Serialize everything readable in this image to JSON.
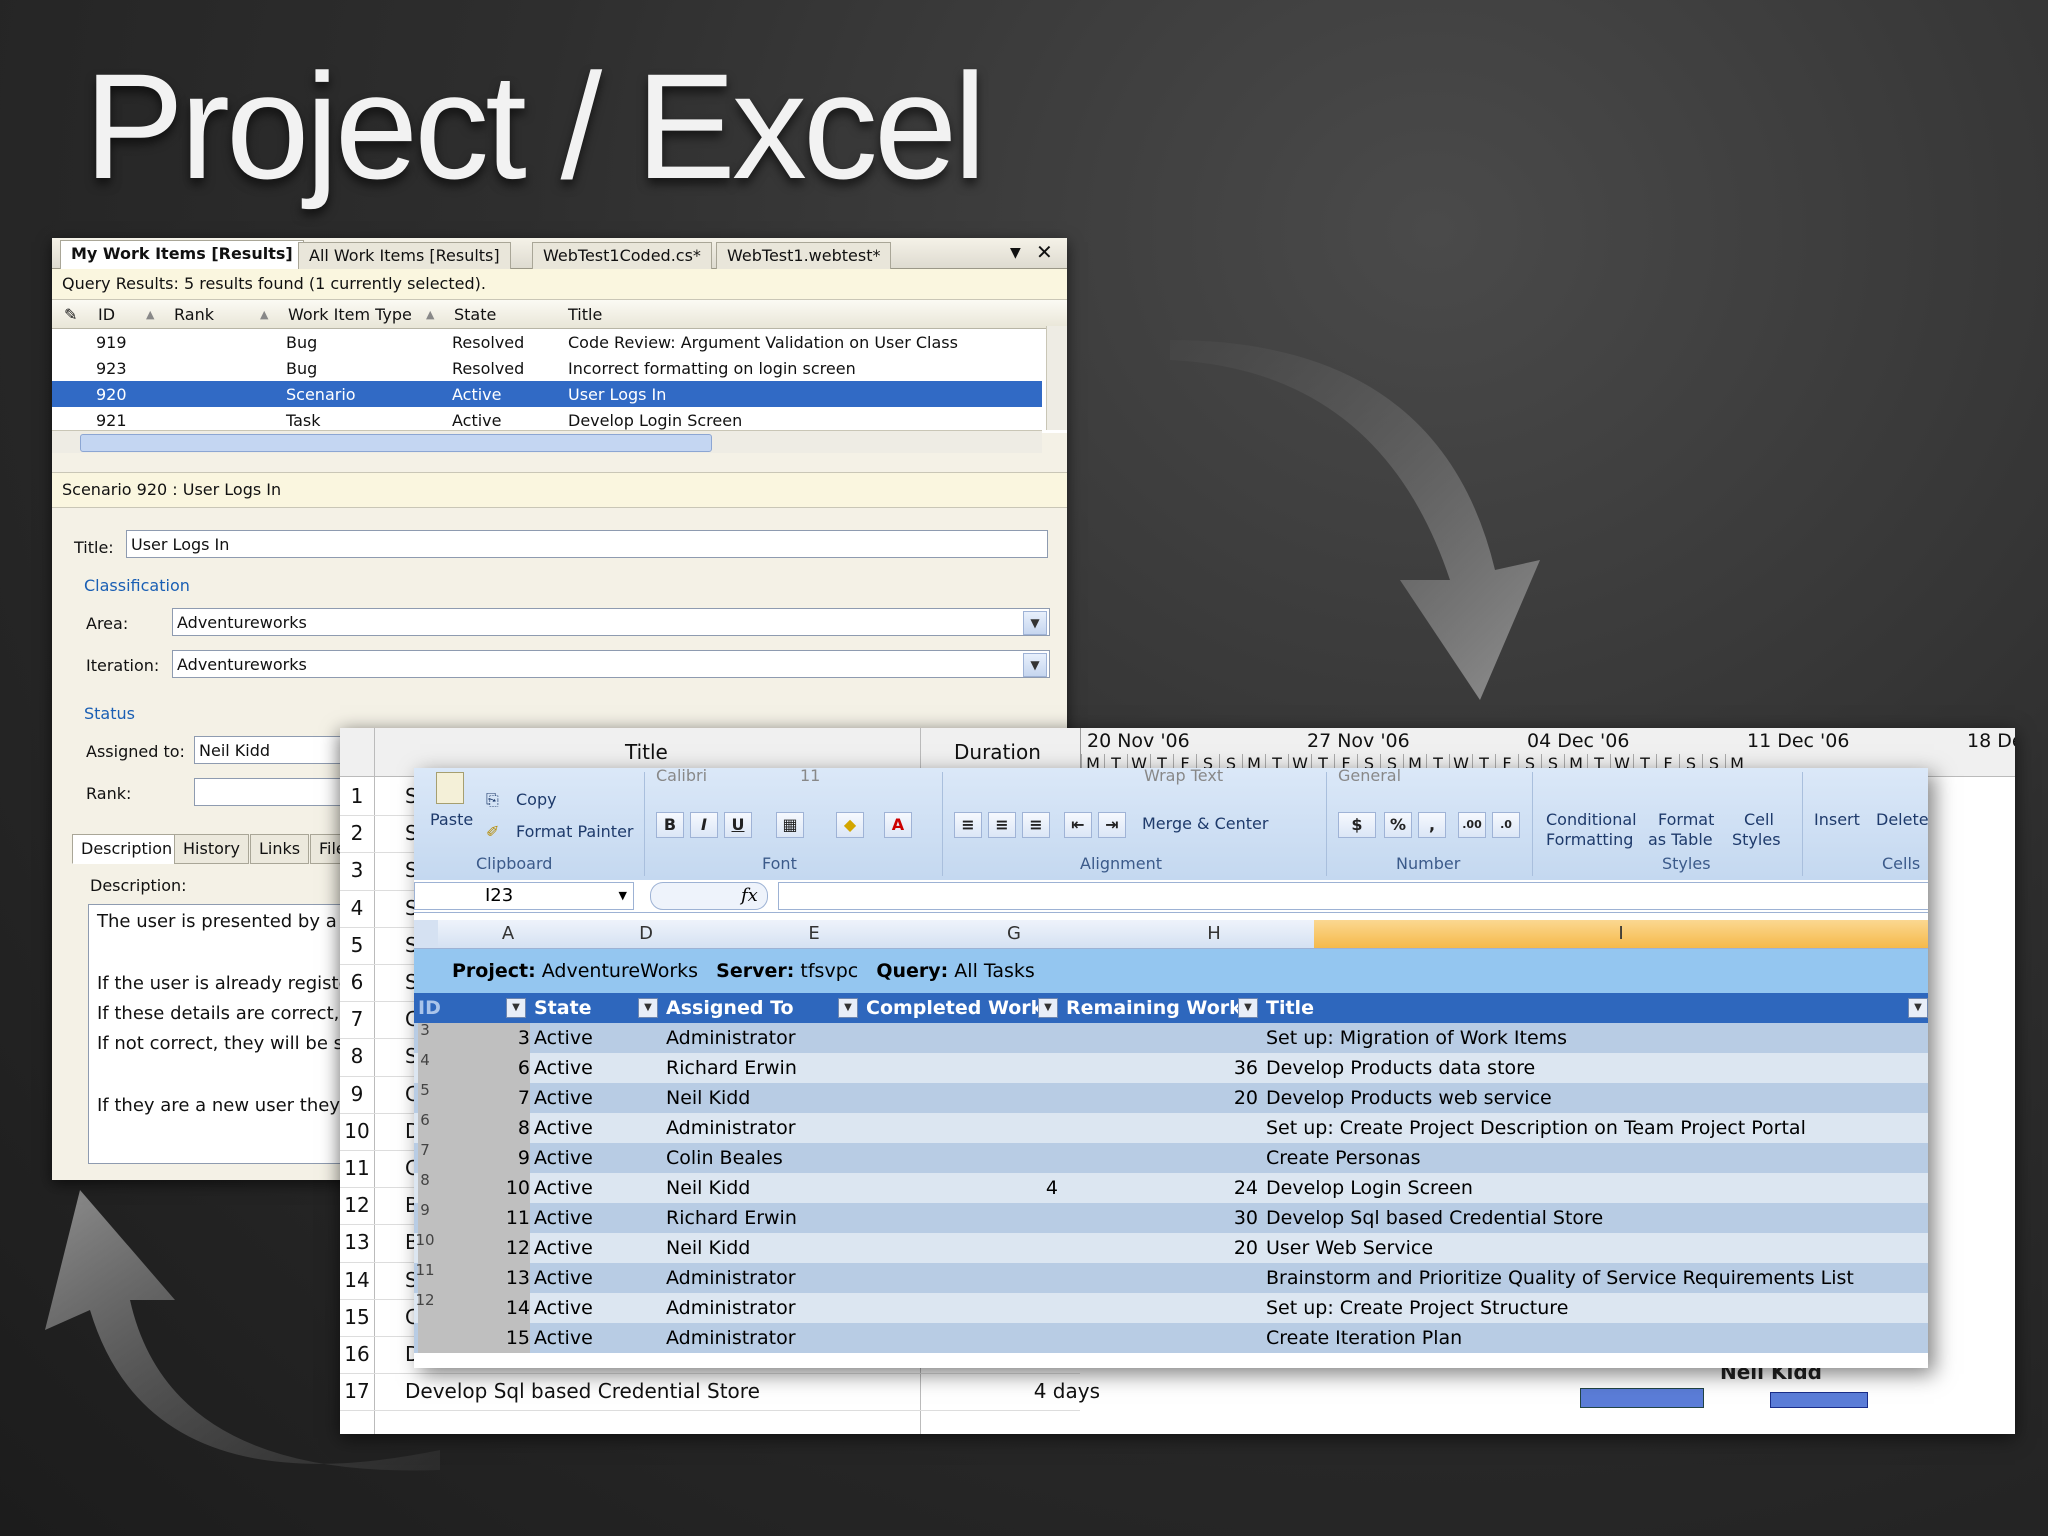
{
  "slide": {
    "title": "Project / Excel"
  },
  "vs": {
    "tabs": [
      "My Work Items [Results]",
      "All Work Items [Results]",
      "WebTest1Coded.cs*",
      "WebTest1.webtest*"
    ],
    "query_info": "Query Results: 5 results found (1 currently selected).",
    "columns": [
      "ID",
      "Rank",
      "Work Item Type",
      "State",
      "Title"
    ],
    "rows": [
      {
        "id": "919",
        "type": "Bug",
        "state": "Resolved",
        "title": "Code Review: Argument Validation on User Class"
      },
      {
        "id": "923",
        "type": "Bug",
        "state": "Resolved",
        "title": "Incorrect formatting on login screen"
      },
      {
        "id": "920",
        "type": "Scenario",
        "state": "Active",
        "title": "User Logs In"
      },
      {
        "id": "921",
        "type": "Task",
        "state": "Active",
        "title": "Develop Login Screen"
      }
    ],
    "form_header": "Scenario 920 : User Logs In",
    "title_label": "Title:",
    "title_value": "User Logs In",
    "classification_label": "Classification",
    "area_label": "Area:",
    "area_value": "Adventureworks",
    "iteration_label": "Iteration:",
    "iteration_value": "Adventureworks",
    "status_label": "Status",
    "assigned_label": "Assigned to:",
    "assigned_value": "Neil Kidd",
    "rank_label": "Rank:",
    "subtabs": [
      "Description",
      "History",
      "Links",
      "File"
    ],
    "description_label": "Description:",
    "description_lines": [
      "The user is presented by a l",
      "",
      "If the user is already registe",
      "If these details are correct, t",
      "If not correct, they will be sh",
      "",
      "If they are a new user they a"
    ]
  },
  "project": {
    "col_title": "Title",
    "col_duration": "Duration",
    "row_numbers": [
      "1",
      "2",
      "3",
      "4",
      "5",
      "6",
      "7",
      "8",
      "9",
      "10",
      "11",
      "12",
      "13",
      "14",
      "15",
      "16",
      "17"
    ],
    "row_prefixes": [
      "Se",
      "Se",
      "Se",
      "Se",
      "Se",
      "Se",
      "Cr",
      "Se",
      "Cr",
      "De",
      "Cr",
      "Bi",
      "Bi",
      "Se",
      "Cr",
      "Develop Login Screen",
      "Develop Sql based Credential Store"
    ],
    "durations": {
      "16": "4 days",
      "17": "4 days"
    },
    "weeks": [
      "20 Nov '06",
      "27 Nov '06",
      "04 Dec '06",
      "11 Dec '06",
      "18 De"
    ],
    "day_letters": "MTWTFSSMTWTFSSMTWTFSSMTWTFSSM",
    "resource_label_1": "Neil Kidd",
    "resource_label_2": "Neil Kidd"
  },
  "excel": {
    "ribbon": {
      "paste": "Paste",
      "copy": "Copy",
      "format_painter": "Format Painter",
      "clipboard": "Clipboard",
      "font_name": "Calibri",
      "font_size": "11",
      "font": "Font",
      "wrap_text": "Wrap Text",
      "merge_center": "Merge & Center",
      "alignment": "Alignment",
      "number_format": "General",
      "number": "Number",
      "conditional": "Conditional",
      "formatting": "Formatting",
      "format": "Format",
      "as_table": "as Table",
      "cell": "Cell",
      "styles_btn": "Styles",
      "styles": "Styles",
      "insert": "Insert",
      "delete": "Delete",
      "cells": "Cells"
    },
    "name_box": "I23",
    "fx": "fx",
    "col_letters": [
      "A",
      "D",
      "E",
      "G",
      "H",
      "I"
    ],
    "project_label": "Project:",
    "project_value": "AdventureWorks",
    "server_label": "Server:",
    "server_value": "tfsvpc",
    "query_label": "Query:",
    "query_value": "All Tasks",
    "headers": [
      "ID",
      "State",
      "Assigned To",
      "Completed Work",
      "Remaining Work",
      "Title"
    ],
    "gutter": [
      "3",
      "4",
      "5",
      "6",
      "7",
      "8",
      "9",
      "10",
      "11",
      "12"
    ],
    "rows": [
      {
        "id": "3",
        "state": "Active",
        "assigned": "Administrator",
        "completed": "",
        "remaining": "",
        "title": "Set up: Migration of Work Items"
      },
      {
        "id": "6",
        "state": "Active",
        "assigned": "Richard Erwin",
        "completed": "",
        "remaining": "36",
        "title": "Develop Products data store"
      },
      {
        "id": "7",
        "state": "Active",
        "assigned": "Neil Kidd",
        "completed": "",
        "remaining": "20",
        "title": "Develop Products web service"
      },
      {
        "id": "8",
        "state": "Active",
        "assigned": "Administrator",
        "completed": "",
        "remaining": "",
        "title": "Set up: Create Project Description on Team Project Portal"
      },
      {
        "id": "9",
        "state": "Active",
        "assigned": "Colin Beales",
        "completed": "",
        "remaining": "",
        "title": "Create Personas"
      },
      {
        "id": "10",
        "state": "Active",
        "assigned": "Neil Kidd",
        "completed": "4",
        "remaining": "24",
        "title": "Develop Login Screen"
      },
      {
        "id": "11",
        "state": "Active",
        "assigned": "Richard Erwin",
        "completed": "",
        "remaining": "30",
        "title": "Develop Sql based Credential Store"
      },
      {
        "id": "12",
        "state": "Active",
        "assigned": "Neil Kidd",
        "completed": "",
        "remaining": "20",
        "title": "User Web Service"
      },
      {
        "id": "13",
        "state": "Active",
        "assigned": "Administrator",
        "completed": "",
        "remaining": "",
        "title": "Brainstorm and Prioritize Quality of Service Requirements List"
      },
      {
        "id": "14",
        "state": "Active",
        "assigned": "Administrator",
        "completed": "",
        "remaining": "",
        "title": "Set up: Create Project Structure"
      },
      {
        "id": "15",
        "state": "Active",
        "assigned": "Administrator",
        "completed": "",
        "remaining": "",
        "title": "Create Iteration Plan"
      }
    ]
  },
  "colors": {
    "selection": "#316ac5",
    "excel_header": "#2e67bd",
    "excel_band": "#b8cce4",
    "project_line": "#94c6f0"
  }
}
